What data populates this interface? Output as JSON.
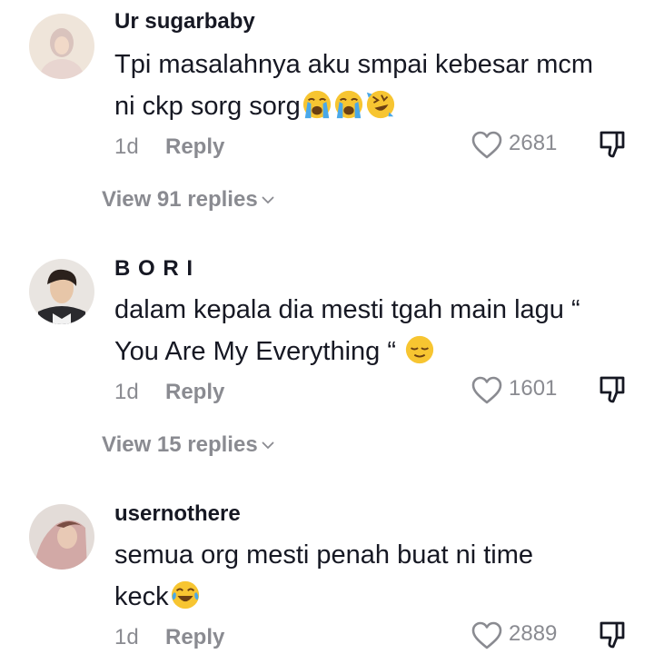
{
  "comments": [
    {
      "username": "Ur sugarbaby",
      "text_line1": "Tpi masalahnya aku smpai kebesar mcm",
      "text_line2": "ni ckp sorg sorg",
      "emojis": [
        "loudly-crying-face",
        "loudly-crying-face",
        "rolling-on-floor-laughing"
      ],
      "time": "1d",
      "reply_label": "Reply",
      "likes": "2681",
      "view_replies": "View 91 replies"
    },
    {
      "username": "B O R I",
      "text_line1": "dalam kepala dia mesti tgah main lagu “",
      "text_line2": "You Are My Everything “",
      "emojis": [
        "relieved-face"
      ],
      "time": "1d",
      "reply_label": "Reply",
      "likes": "1601",
      "view_replies": "View 15 replies"
    },
    {
      "username": "usernothere",
      "text_line1": "semua org mesti penah buat ni time",
      "text_line2": "keck",
      "emojis": [
        "face-with-tears-of-joy"
      ],
      "time": "1d",
      "reply_label": "Reply",
      "likes": "2889"
    }
  ],
  "colors": {
    "primary_text": "#161823",
    "secondary_text": "#8a8b91",
    "emoji_yellow": "#f7c531",
    "emoji_tear": "#4aa8e8"
  }
}
